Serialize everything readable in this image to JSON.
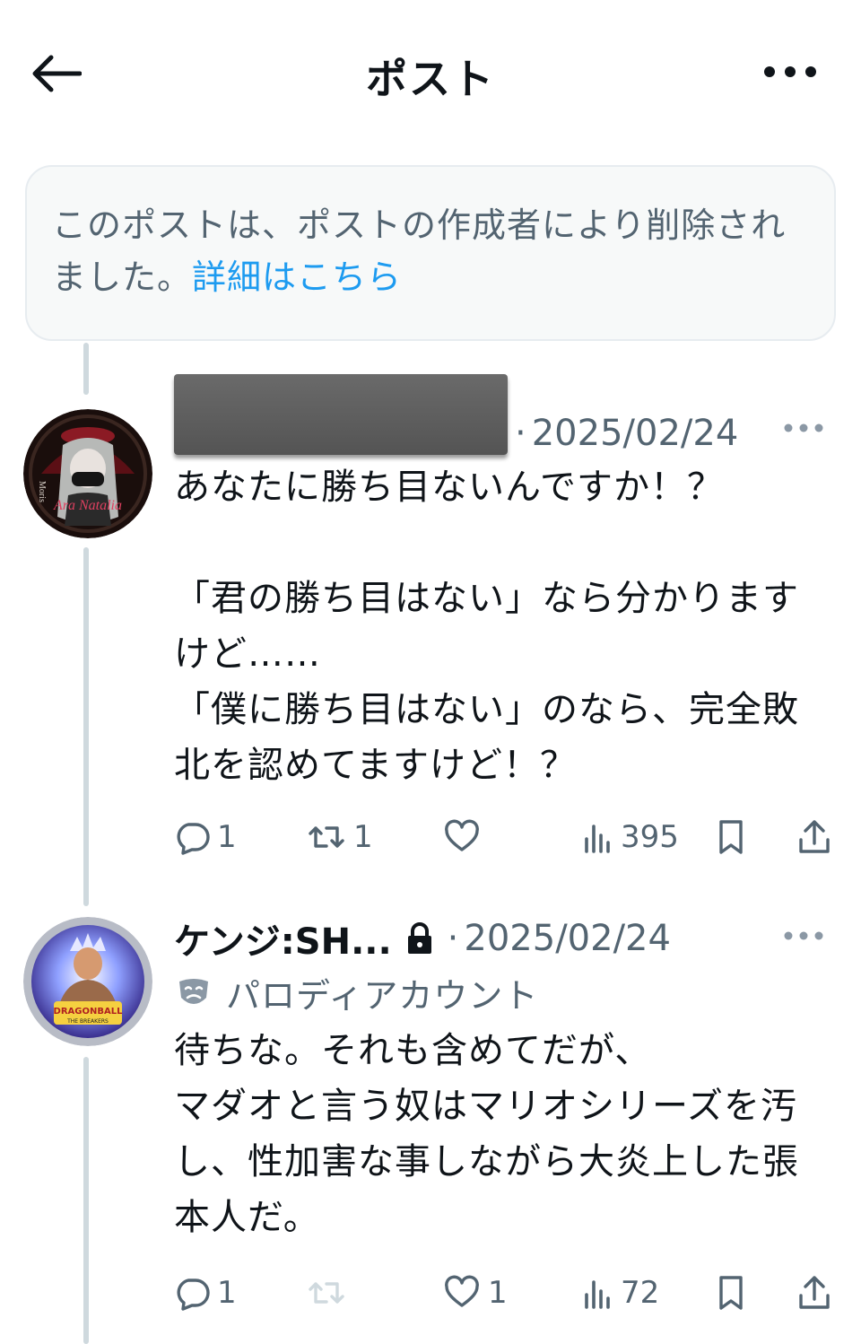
{
  "header": {
    "title": "ポスト"
  },
  "notice": {
    "text": "このポストは、ポストの作成者により削除されました。",
    "link": "詳細はこちら"
  },
  "posts": [
    {
      "date": "2025/02/24",
      "body": "あなたに勝ち目ないんですか！？\n\n「君の勝ち目はない」なら分かりますけど……\n「僕に勝ち目はない」のなら、完全敗北を認めてますけど！？",
      "replies": "1",
      "reposts": "1",
      "likes": "",
      "views": "395",
      "avatar_text": [
        "Moris",
        "Ara Natalia"
      ]
    },
    {
      "author": "ケンジ:SH...",
      "date": "2025/02/24",
      "badge": "パロディアカウント",
      "body": "待ちな。それも含めてだが、\nマダオと言う奴はマリオシリーズを汚し、性加害な事しながら大炎上した張本人だ。",
      "replies": "1",
      "reposts": "",
      "likes": "1",
      "views": "72",
      "avatar_text": [
        "DRAGONBALL",
        "THE BREAKERS"
      ]
    }
  ],
  "colors": {
    "text": "#0f1419",
    "secondary": "#536471",
    "link": "#1d9bf0",
    "thread_line": "#cfd9de",
    "notice_bg": "#f7f9f9"
  },
  "icons": [
    "back-arrow-icon",
    "more-icon",
    "reply-icon",
    "repost-icon",
    "like-icon",
    "views-icon",
    "bookmark-icon",
    "share-icon",
    "lock-icon",
    "mask-icon"
  ]
}
